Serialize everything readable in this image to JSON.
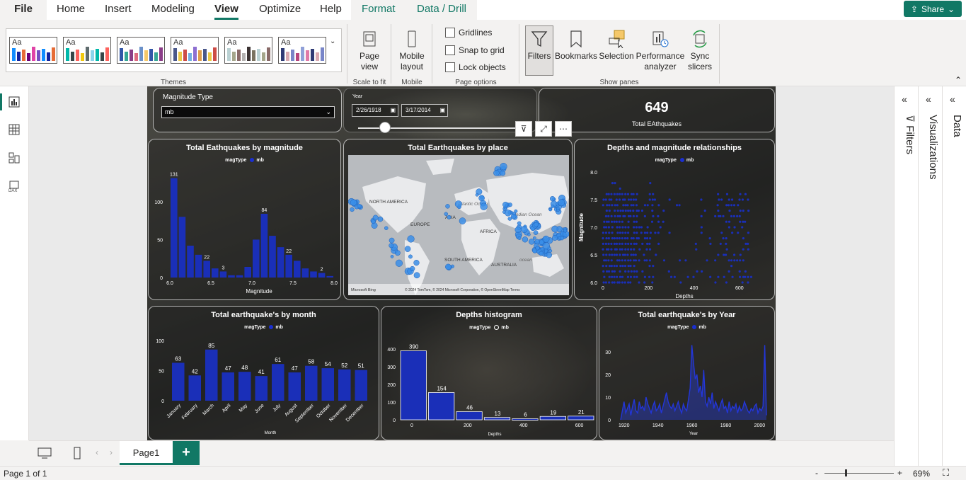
{
  "ribbon_tabs": [
    "File",
    "Home",
    "Insert",
    "Modeling",
    "View",
    "Optimize",
    "Help",
    "Format",
    "Data / Drill"
  ],
  "active_tab": "View",
  "share_label": "Share",
  "themes_label": "Themes",
  "scale_buttons": {
    "page_view": "Page view",
    "mobile_layout": "Mobile layout"
  },
  "scale_label": "Scale to fit",
  "mobile_label": "Mobile",
  "page_options": {
    "gridlines": "Gridlines",
    "snap": "Snap to grid",
    "lock": "Lock objects",
    "label": "Page options"
  },
  "show_panes": {
    "filters": "Filters",
    "bookmarks": "Bookmarks",
    "selection": "Selection",
    "performance": "Performance analyzer",
    "sync": "Sync slicers",
    "label": "Show panes"
  },
  "theme_colors": [
    [
      "#118dff",
      "#12239e",
      "#e66c37",
      "#6b007b",
      "#e044a7",
      "#744ec2"
    ],
    [
      "#01b8aa",
      "#374649",
      "#fd625e",
      "#f2c80f",
      "#5f6b6d",
      "#8ad4eb"
    ],
    [
      "#3257a8",
      "#37a794",
      "#8b3d88",
      "#dd6b7f",
      "#6b91c9",
      "#f5c869"
    ],
    [
      "#4a588a",
      "#ecc846",
      "#cd4c46",
      "#71afe2",
      "#8d6fd1",
      "#e09d4b"
    ],
    [
      "#bad1d3",
      "#a5a68b",
      "#896a68",
      "#b3b1b0",
      "#3b3232",
      "#7b7260"
    ],
    [
      "#2e3a75",
      "#d8a9b0",
      "#7885c8",
      "#b6457c",
      "#90a0d8",
      "#e079a7"
    ]
  ],
  "slicer": {
    "title": "Magnitude Type",
    "value": "mb"
  },
  "year_slicer": {
    "title": "Year",
    "start": "2/26/1918",
    "end": "3/17/2014"
  },
  "kpi": {
    "value": "649",
    "label": "Total EAthquakes"
  },
  "legend": {
    "field": "magType",
    "item": "mb"
  },
  "map": {
    "title": "Total Earthquakes by place",
    "labels": [
      "NORTH AMERICA",
      "EUROPE",
      "ASIA",
      "Atlantic Ocean",
      "AFRICA",
      "SOUTH AMERICA",
      "Indian Ocean",
      "AUSTRALIA",
      "ocean"
    ],
    "credit": "© 2024 TomTom, © 2024 Microsoft Corporation, © OpenStreetMap  Terms",
    "bing": "Microsoft Bing"
  },
  "chart_data": [
    {
      "type": "bar",
      "title": "Total Eathquakes by magnitude",
      "xlabel": "Magnitude",
      "x": [
        6.0,
        6.1,
        6.2,
        6.3,
        6.4,
        6.5,
        6.6,
        6.7,
        6.8,
        6.9,
        7.0,
        7.1,
        7.2,
        7.3,
        7.4,
        7.5,
        7.6,
        7.7,
        7.8,
        7.9
      ],
      "values": [
        131,
        80,
        42,
        30,
        22,
        12,
        8,
        3,
        3,
        14,
        50,
        84,
        55,
        40,
        30,
        22,
        12,
        8,
        6,
        2
      ],
      "data_labels": {
        "0": "131",
        "4": "22",
        "6": "3",
        "11": "84",
        "14": "22",
        "18": "2"
      },
      "xticks": [
        "6.0",
        "6.5",
        "7.0",
        "7.5",
        "8.0"
      ],
      "yticks": [
        "0",
        "50",
        "100"
      ],
      "ylim": [
        0,
        140
      ]
    },
    {
      "type": "scatter",
      "title": "Depths and magnitude relationships",
      "xlabel": "Depths",
      "ylabel": "Magnitude",
      "xticks": [
        "0",
        "200",
        "400",
        "600"
      ],
      "yticks": [
        "6.0",
        "6.5",
        "7.0",
        "7.5",
        "8.0"
      ],
      "xlim": [
        0,
        700
      ],
      "ylim": [
        6.0,
        8.0
      ]
    },
    {
      "type": "bar",
      "title": "Total earthquake's by month",
      "xlabel": "Month",
      "categories": [
        "January",
        "February",
        "March",
        "April",
        "May",
        "June",
        "July",
        "August",
        "September",
        "October",
        "November",
        "December"
      ],
      "values": [
        63,
        42,
        85,
        47,
        48,
        41,
        61,
        47,
        58,
        54,
        52,
        51
      ],
      "yticks": [
        "0",
        "50",
        "100"
      ],
      "ylim": [
        0,
        100
      ]
    },
    {
      "type": "bar",
      "title": "Depths histogram",
      "xlabel": "Depths",
      "bins": [
        0,
        100,
        200,
        300,
        400,
        500,
        600
      ],
      "values": [
        390,
        154,
        46,
        13,
        6,
        19,
        21
      ],
      "xticks": [
        "0",
        "200",
        "400",
        "600"
      ],
      "yticks": [
        "0",
        "100",
        "200",
        "300",
        "400"
      ],
      "ylim": [
        0,
        400
      ]
    },
    {
      "type": "area",
      "title": "Total earthquake's by Year",
      "xlabel": "Year",
      "x_start": 1918,
      "values": [
        0,
        4,
        8,
        3,
        5,
        7,
        2,
        6,
        9,
        4,
        3,
        8,
        5,
        6,
        4,
        10,
        7,
        5,
        3,
        6,
        8,
        4,
        5,
        7,
        3,
        6,
        9,
        12,
        8,
        6,
        5,
        7,
        4,
        6,
        8,
        5,
        3,
        7,
        5,
        4,
        9,
        14,
        33,
        25,
        18,
        20,
        12,
        15,
        10,
        22,
        8,
        6,
        10,
        7,
        12,
        5,
        8,
        6,
        4,
        7,
        9,
        5,
        6,
        3,
        8,
        4,
        6,
        5,
        7,
        3,
        6,
        4,
        5,
        8,
        6,
        4,
        3,
        5,
        4,
        6,
        7,
        3,
        5,
        4,
        6,
        33,
        2
      ],
      "xticks": [
        "1920",
        "1940",
        "1960",
        "1980",
        "2000"
      ],
      "yticks": [
        "0",
        "10",
        "20",
        "30"
      ],
      "ylim": [
        0,
        35
      ]
    }
  ],
  "panes": {
    "filters": "Filters",
    "visualizations": "Visualizations",
    "data": "Data"
  },
  "page_tab": "Page1",
  "status": {
    "page": "Page 1 of 1",
    "zoom": "69%"
  }
}
